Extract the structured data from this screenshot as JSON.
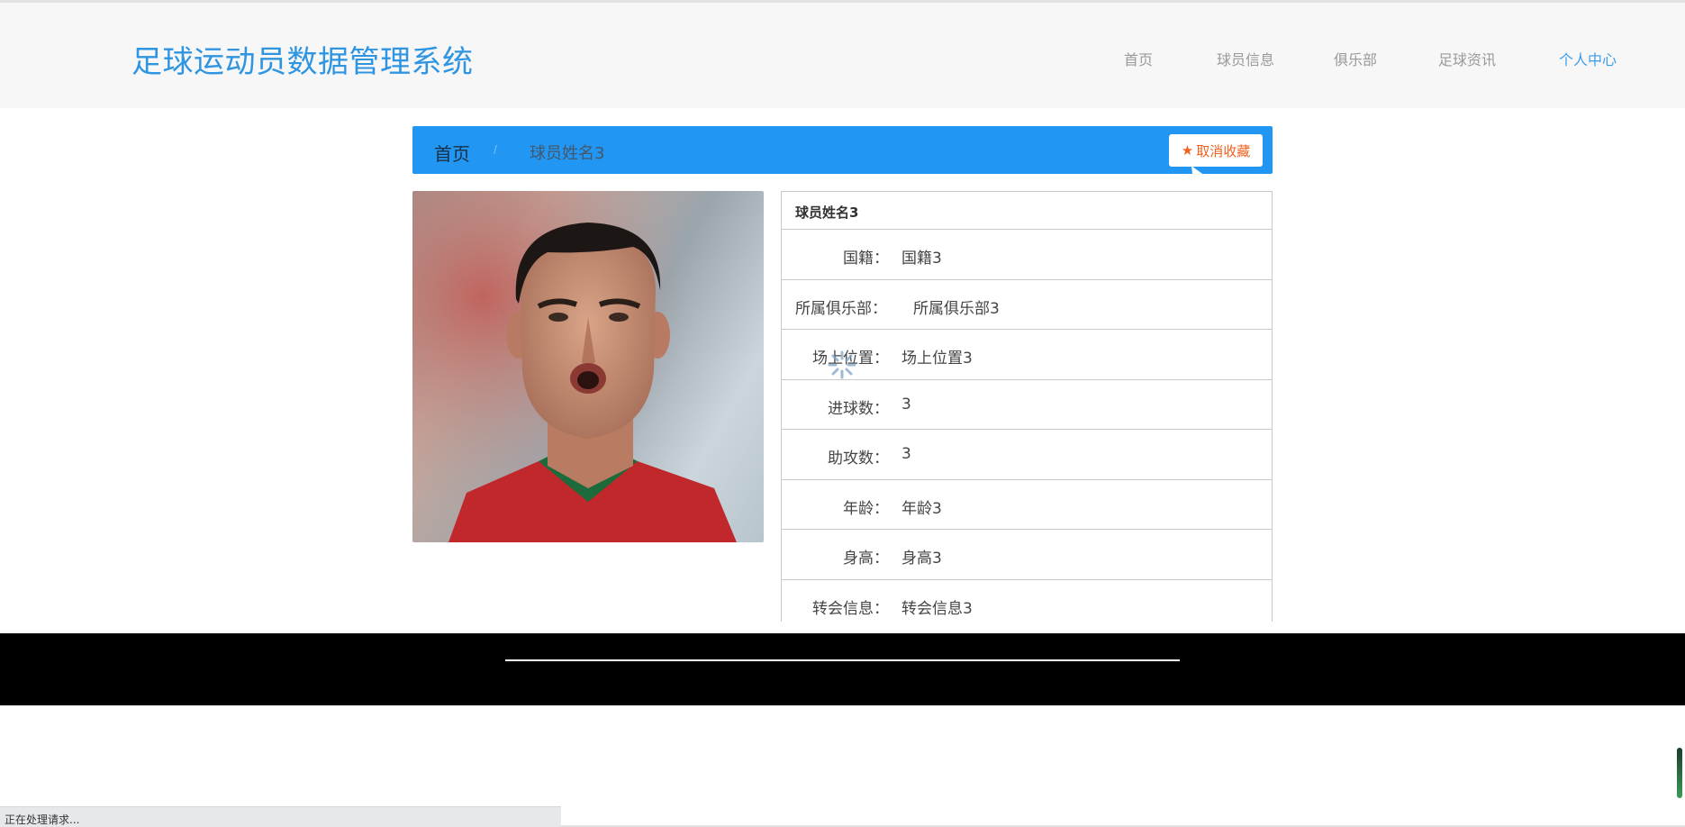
{
  "header": {
    "title": "足球运动员数据管理系统",
    "nav": [
      "首页",
      "球员信息",
      "俱乐部",
      "足球资讯",
      "个人中心"
    ],
    "active_nav": "个人中心"
  },
  "breadcrumb": {
    "home": "首页",
    "separator": "/",
    "current": "球员姓名3",
    "fav_button": "取消收藏",
    "fav_icon": "star-icon"
  },
  "player": {
    "name": "球员姓名3",
    "fields": [
      {
        "label": "国籍：",
        "value": "国籍3"
      },
      {
        "label": "所属俱乐部：",
        "value": "所属俱乐部3"
      },
      {
        "label": "场上位置：",
        "value": "场上位置3"
      },
      {
        "label": "进球数：",
        "value": "3"
      },
      {
        "label": "助攻数：",
        "value": "3"
      },
      {
        "label": "年龄：",
        "value": "年龄3"
      },
      {
        "label": "身高：",
        "value": "身高3"
      },
      {
        "label": "转会信息：",
        "value": "转会信息3"
      }
    ]
  },
  "status": {
    "text": "正在处理请求..."
  },
  "colors": {
    "accent": "#2196f3",
    "title": "#2f95e0",
    "fav": "#f0601e",
    "footer": "#000000"
  }
}
